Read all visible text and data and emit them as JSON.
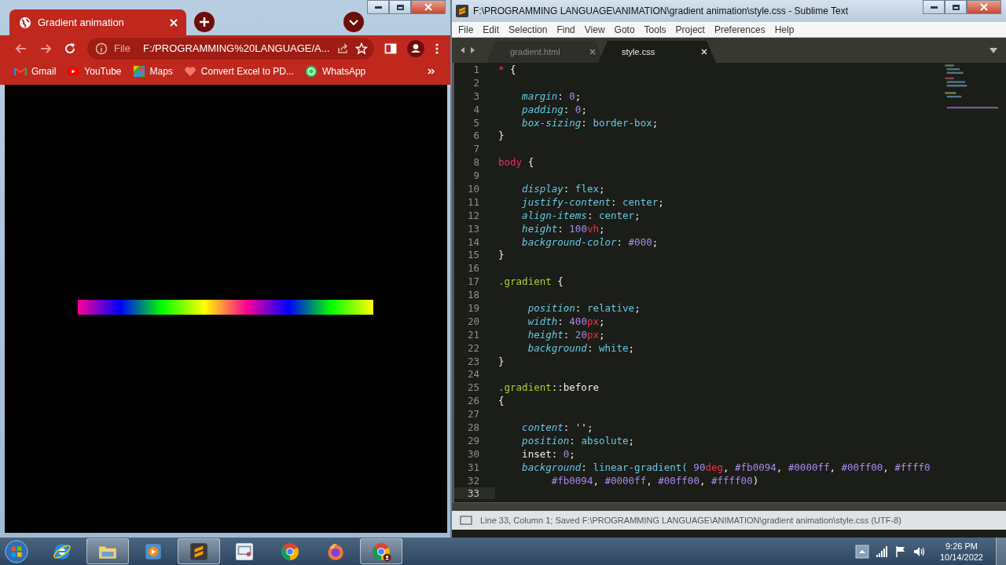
{
  "browser": {
    "tab": {
      "title": "Gradient animation"
    },
    "address": {
      "scheme": "File",
      "url": "F:/PROGRAMMING%20LANGUAGE/A..."
    },
    "bookmarks": [
      {
        "kind": "gmail",
        "label": "Gmail"
      },
      {
        "kind": "youtube",
        "label": "YouTube"
      },
      {
        "kind": "maps",
        "label": "Maps"
      },
      {
        "kind": "heart",
        "label": "Convert Excel to PD..."
      },
      {
        "kind": "whatsapp",
        "label": "WhatsApp"
      }
    ]
  },
  "editor": {
    "title": "F:\\PROGRAMMING LANGUAGE\\ANIMATION\\gradient animation\\style.css - Sublime Text",
    "menu": [
      "File",
      "Edit",
      "Selection",
      "Find",
      "View",
      "Goto",
      "Tools",
      "Project",
      "Preferences",
      "Help"
    ],
    "tabs": [
      {
        "label": "gradient.html",
        "selected": false
      },
      {
        "label": "style.css",
        "selected": true
      }
    ],
    "lines": [
      {
        "number": "1",
        "current": false,
        "tokens": [
          {
            "kind": "sel",
            "text": "*"
          },
          {
            "kind": "p",
            "text": " {"
          }
        ]
      },
      {
        "number": "2",
        "current": false
      },
      {
        "number": "3",
        "current": false,
        "tokens": [
          {
            "kind": "prop",
            "text": "    margin"
          },
          {
            "kind": "p",
            "text": ": "
          },
          {
            "kind": "num",
            "text": "0"
          },
          {
            "kind": "p",
            "text": ";"
          }
        ]
      },
      {
        "number": "4",
        "current": false,
        "tokens": [
          {
            "kind": "prop",
            "text": "    padding"
          },
          {
            "kind": "p",
            "text": ": "
          },
          {
            "kind": "num",
            "text": "0"
          },
          {
            "kind": "p",
            "text": ";"
          }
        ]
      },
      {
        "number": "5",
        "current": false,
        "tokens": [
          {
            "kind": "prop",
            "text": "    box-sizing"
          },
          {
            "kind": "p",
            "text": ": "
          },
          {
            "kind": "val",
            "text": "border-box"
          },
          {
            "kind": "p",
            "text": ";"
          }
        ]
      },
      {
        "number": "6",
        "current": false,
        "tokens": [
          {
            "kind": "p",
            "text": "}"
          }
        ]
      },
      {
        "number": "7",
        "current": false
      },
      {
        "number": "8",
        "current": false,
        "tokens": [
          {
            "kind": "sel",
            "text": "body"
          },
          {
            "kind": "p",
            "text": " {"
          }
        ]
      },
      {
        "number": "9",
        "current": false
      },
      {
        "number": "10",
        "current": false,
        "tokens": [
          {
            "kind": "prop",
            "text": "    display"
          },
          {
            "kind": "p",
            "text": ": "
          },
          {
            "kind": "val",
            "text": "flex"
          },
          {
            "kind": "p",
            "text": ";"
          }
        ]
      },
      {
        "number": "11",
        "current": false,
        "tokens": [
          {
            "kind": "prop",
            "text": "    justify-content"
          },
          {
            "kind": "p",
            "text": ": "
          },
          {
            "kind": "val",
            "text": "center"
          },
          {
            "kind": "p",
            "text": ";"
          }
        ]
      },
      {
        "number": "12",
        "current": false,
        "tokens": [
          {
            "kind": "prop",
            "text": "    align-items"
          },
          {
            "kind": "p",
            "text": ": "
          },
          {
            "kind": "val",
            "text": "center"
          },
          {
            "kind": "p",
            "text": ";"
          }
        ]
      },
      {
        "number": "13",
        "current": false,
        "tokens": [
          {
            "kind": "prop",
            "text": "    height"
          },
          {
            "kind": "p",
            "text": ": "
          },
          {
            "kind": "num",
            "text": "100"
          },
          {
            "kind": "unit",
            "text": "vh"
          },
          {
            "kind": "p",
            "text": ";"
          }
        ]
      },
      {
        "number": "14",
        "current": false,
        "tokens": [
          {
            "kind": "prop",
            "text": "    background-color"
          },
          {
            "kind": "p",
            "text": ": "
          },
          {
            "kind": "num",
            "text": "#000"
          },
          {
            "kind": "p",
            "text": ";"
          }
        ]
      },
      {
        "number": "15",
        "current": false,
        "tokens": [
          {
            "kind": "p",
            "text": "}"
          }
        ]
      },
      {
        "number": "16",
        "current": false
      },
      {
        "number": "17",
        "current": false,
        "tokens": [
          {
            "kind": "cls",
            "text": ".gradient"
          },
          {
            "kind": "p",
            "text": " {"
          }
        ]
      },
      {
        "number": "18",
        "current": false
      },
      {
        "number": "19",
        "current": false,
        "tokens": [
          {
            "kind": "prop",
            "text": "     position"
          },
          {
            "kind": "p",
            "text": ": "
          },
          {
            "kind": "val",
            "text": "relative"
          },
          {
            "kind": "p",
            "text": ";"
          }
        ]
      },
      {
        "number": "20",
        "current": false,
        "tokens": [
          {
            "kind": "prop",
            "text": "     width"
          },
          {
            "kind": "p",
            "text": ": "
          },
          {
            "kind": "num",
            "text": "400"
          },
          {
            "kind": "unit",
            "text": "px"
          },
          {
            "kind": "p",
            "text": ";"
          }
        ]
      },
      {
        "number": "21",
        "current": false,
        "tokens": [
          {
            "kind": "prop",
            "text": "     height"
          },
          {
            "kind": "p",
            "text": ": "
          },
          {
            "kind": "num",
            "text": "20"
          },
          {
            "kind": "unit",
            "text": "px"
          },
          {
            "kind": "p",
            "text": ";"
          }
        ]
      },
      {
        "number": "22",
        "current": false,
        "tokens": [
          {
            "kind": "prop",
            "text": "     background"
          },
          {
            "kind": "p",
            "text": ": "
          },
          {
            "kind": "val",
            "text": "white"
          },
          {
            "kind": "p",
            "text": ";"
          }
        ]
      },
      {
        "number": "23",
        "current": false,
        "tokens": [
          {
            "kind": "p",
            "text": "}"
          }
        ]
      },
      {
        "number": "24",
        "current": false
      },
      {
        "number": "25",
        "current": false,
        "tokens": [
          {
            "kind": "cls",
            "text": ".gradient"
          },
          {
            "kind": "p",
            "text": "::before"
          }
        ]
      },
      {
        "number": "26",
        "current": false,
        "tokens": [
          {
            "kind": "p",
            "text": "{"
          }
        ]
      },
      {
        "number": "27",
        "current": false
      },
      {
        "number": "28",
        "current": false,
        "tokens": [
          {
            "kind": "prop",
            "text": "    content"
          },
          {
            "kind": "p",
            "text": ": '';"
          }
        ]
      },
      {
        "number": "29",
        "current": false,
        "tokens": [
          {
            "kind": "prop",
            "text": "    position"
          },
          {
            "kind": "p",
            "text": ": "
          },
          {
            "kind": "val",
            "text": "absolute"
          },
          {
            "kind": "p",
            "text": ";"
          }
        ]
      },
      {
        "number": "30",
        "current": false,
        "tokens": [
          {
            "kind": "p",
            "text": "    inset: "
          },
          {
            "kind": "num",
            "text": "0"
          },
          {
            "kind": "p",
            "text": ";"
          }
        ]
      },
      {
        "number": "31",
        "current": false,
        "tokens": [
          {
            "kind": "prop",
            "text": "    background"
          },
          {
            "kind": "p",
            "text": ": "
          },
          {
            "kind": "val",
            "text": "linear-gradient("
          },
          {
            "kind": "num",
            "text": " 90"
          },
          {
            "kind": "unit",
            "text": "deg"
          },
          {
            "kind": "p",
            "text": ", "
          },
          {
            "kind": "num",
            "text": "#fb0094"
          },
          {
            "kind": "p",
            "text": ", "
          },
          {
            "kind": "num",
            "text": "#0000ff"
          },
          {
            "kind": "p",
            "text": ", "
          },
          {
            "kind": "num",
            "text": "#00ff00"
          },
          {
            "kind": "p",
            "text": ", "
          },
          {
            "kind": "num",
            "text": "#ffff0"
          }
        ]
      },
      {
        "number": "32",
        "current": false,
        "tokens": [
          {
            "kind": "num",
            "text": "         #fb0094"
          },
          {
            "kind": "p",
            "text": ", "
          },
          {
            "kind": "num",
            "text": "#0000ff"
          },
          {
            "kind": "p",
            "text": ", "
          },
          {
            "kind": "num",
            "text": "#00ff00"
          },
          {
            "kind": "p",
            "text": ", "
          },
          {
            "kind": "num",
            "text": "#ffff00"
          },
          {
            "kind": "p",
            "text": ")"
          }
        ]
      },
      {
        "number": "33",
        "current": true
      }
    ],
    "status": "Line 33, Column 1; Saved F:\\PROGRAMMING LANGUAGE\\ANIMATION\\gradient animation\\style.css (UTF-8)"
  },
  "taskbar": {
    "items": [
      {
        "kind": "ie",
        "active": false
      },
      {
        "kind": "explorer",
        "active": true
      },
      {
        "kind": "media",
        "active": false
      },
      {
        "kind": "sublime",
        "active": true
      },
      {
        "kind": "remote",
        "active": false
      },
      {
        "kind": "chrome",
        "active": false
      },
      {
        "kind": "firefox",
        "active": false
      },
      {
        "kind": "chrome-profile",
        "active": true
      }
    ],
    "clock": {
      "time": "9:26 PM",
      "date": "10/14/2022"
    }
  }
}
